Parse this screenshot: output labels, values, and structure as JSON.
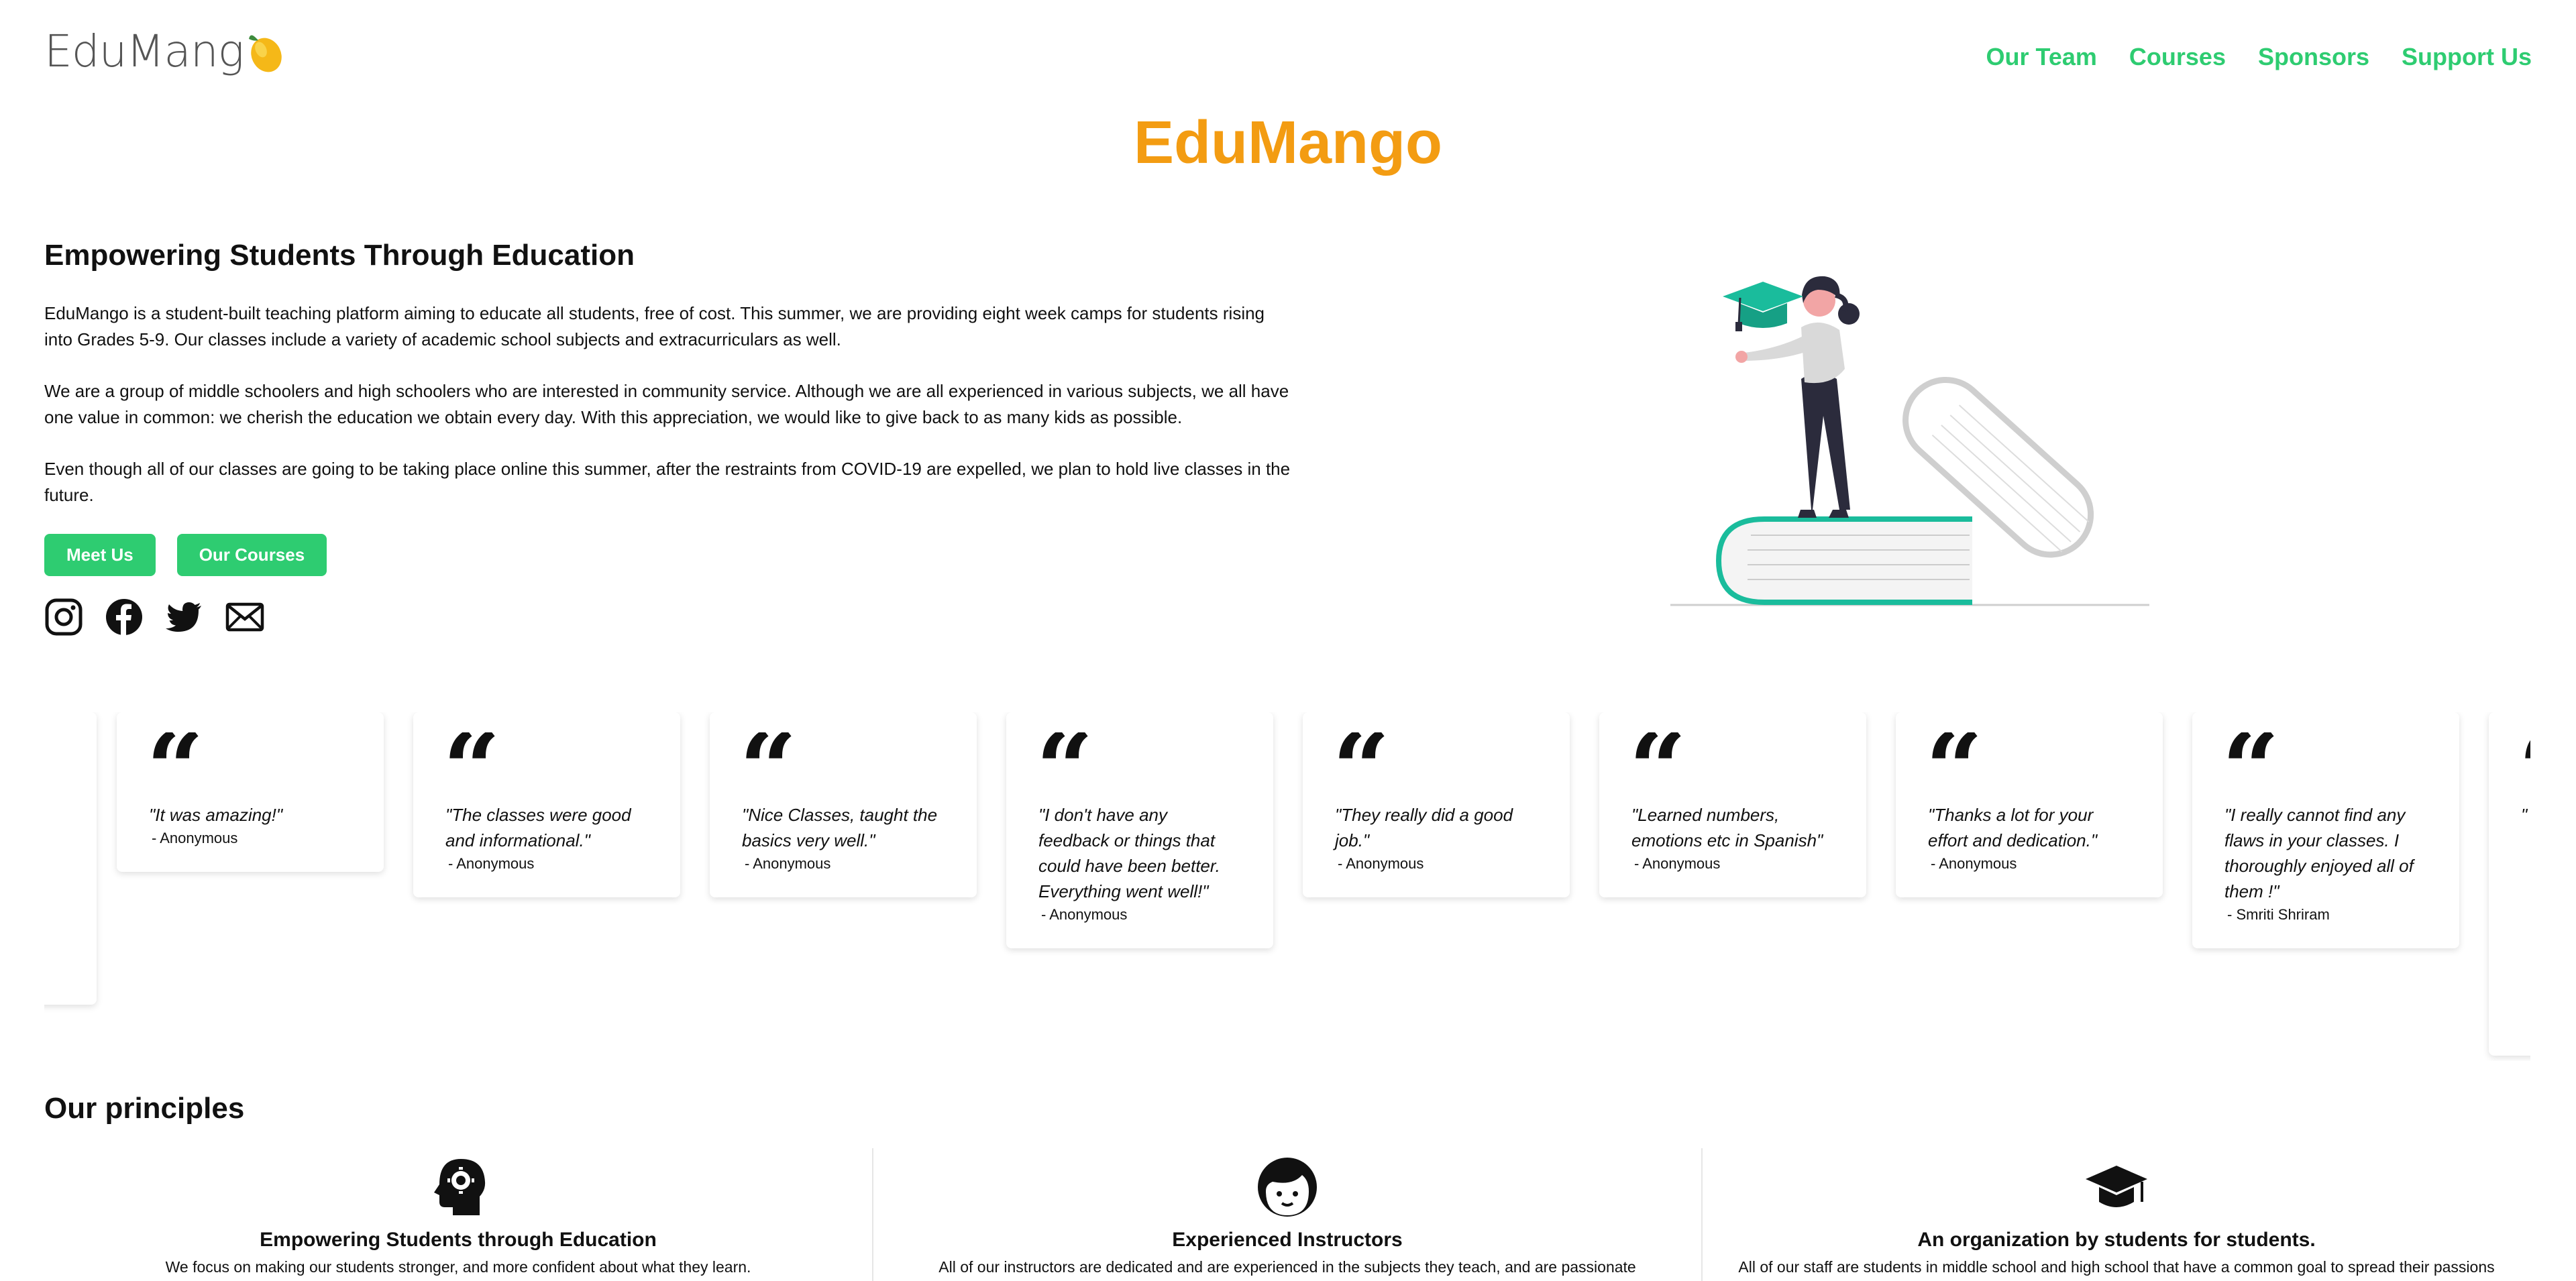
{
  "header": {
    "logo_text": "EduMang",
    "nav": [
      "Our Team",
      "Courses",
      "Sponsors",
      "Support Us"
    ]
  },
  "brand_title": "EduMango",
  "hero": {
    "heading": "Empowering Students Through Education",
    "paragraphs": [
      "EduMango is a student-built teaching platform aiming to educate all students, free of cost. This summer, we are providing eight week camps for students rising into Grades 5-9. Our classes include a variety of academic school subjects and extracurriculars as well.",
      "We are a group of middle schoolers and high schoolers who are interested in community service. Although we are all experienced in various subjects, we all have one value in common: we cherish the education we obtain every day. With this appreciation, we would like to give back to as many kids as possible.",
      "Even though all of our classes are going to be taking place online this summer, after the restraints from COVID-19 are expelled, we plan to hold live classes in the future."
    ],
    "buttons": {
      "meet": "Meet Us",
      "courses": "Our Courses"
    },
    "social_icons": [
      "instagram-icon",
      "facebook-icon",
      "twitter-icon",
      "mail-icon"
    ]
  },
  "testimonials": [
    {
      "quote_mark": "“",
      "text": "\"It was amazing!\"",
      "author": "- Anonymous"
    },
    {
      "quote_mark": "“",
      "text": "\"The classes were good and informational.\"",
      "author": "- Anonymous"
    },
    {
      "quote_mark": "“",
      "text": "\"Nice Classes, taught the basics very well.\"",
      "author": "- Anonymous"
    },
    {
      "quote_mark": "“",
      "text": "\"I don't have any feedback or things that could have been better. Everything went well!\"",
      "author": "- Anonymous"
    },
    {
      "quote_mark": "“",
      "text": "\"They really did a good job.\"",
      "author": "- Anonymous"
    },
    {
      "quote_mark": "“",
      "text": "\"Learned numbers, emotions etc in Spanish\"",
      "author": "- Anonymous"
    },
    {
      "quote_mark": "“",
      "text": "\"Thanks a lot for your effort and dedication.\"",
      "author": "- Anonymous"
    },
    {
      "quote_mark": "“",
      "text": "\"I really cannot find any flaws in your classes. I thoroughly enjoyed all of them !\"",
      "author": "- Smriti Shriram"
    },
    {
      "quote_mark": "“",
      "text": "\"",
      "author": ""
    }
  ],
  "principles": {
    "title": "Our principles",
    "items": [
      {
        "icon": "head-gear-icon",
        "title": "Empowering Students through Education",
        "text": "We focus on making our students stronger, and more confident about what they learn."
      },
      {
        "icon": "instructor-face-icon",
        "title": "Experienced Instructors",
        "text": "All of our instructors are dedicated and are experienced in the subjects they teach, and are passionate"
      },
      {
        "icon": "graduation-cap-icon",
        "title": "An organization by students for students.",
        "text": "All of our staff are students in middle school and high school that have a common goal to spread their passions"
      }
    ]
  },
  "colors": {
    "accent_green": "#2ecc71",
    "brand_orange": "#f39c12",
    "teal": "#1abc9c"
  }
}
